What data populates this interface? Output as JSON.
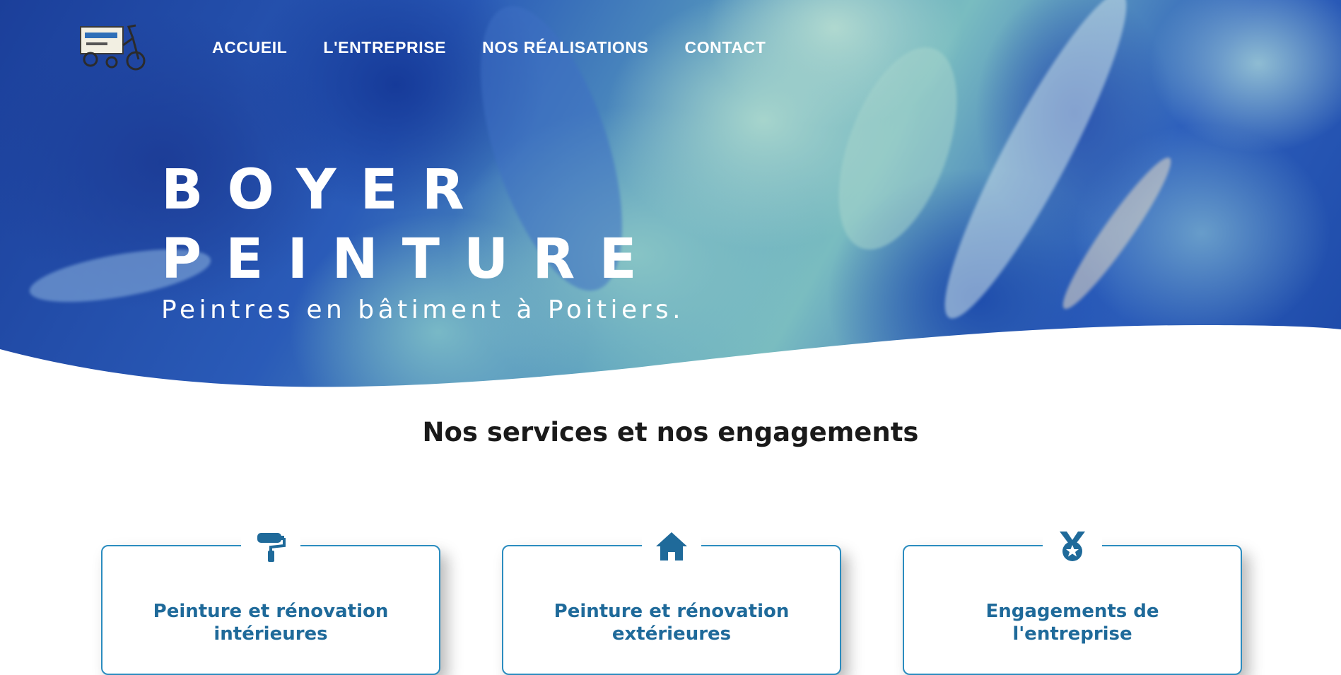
{
  "nav": {
    "logo_alt": "Boyer Peinture cargo bike logo",
    "items": [
      "ACCUEIL",
      "L'ENTREPRISE",
      "NOS RÉALISATIONS",
      "CONTACT"
    ]
  },
  "hero": {
    "brand_line1": "BOYER",
    "brand_line2": "PEINTURE",
    "tagline": "Peintres en bâtiment à Poitiers."
  },
  "services": {
    "title": "Nos services et nos engagements",
    "cards": [
      {
        "icon": "paint-roller-icon",
        "title_line1": "Peinture et rénovation",
        "title_line2": "intérieures"
      },
      {
        "icon": "house-icon",
        "title_line1": "Peinture et rénovation",
        "title_line2": "extérieures"
      },
      {
        "icon": "medal-icon",
        "title_line1": "Engagements de",
        "title_line2": "l'entreprise"
      }
    ]
  },
  "colors": {
    "accent": "#1f6a9a",
    "card_border": "#2b8cbf",
    "hero_blue": "#1b3f9a",
    "hero_teal": "#79bcc0"
  }
}
